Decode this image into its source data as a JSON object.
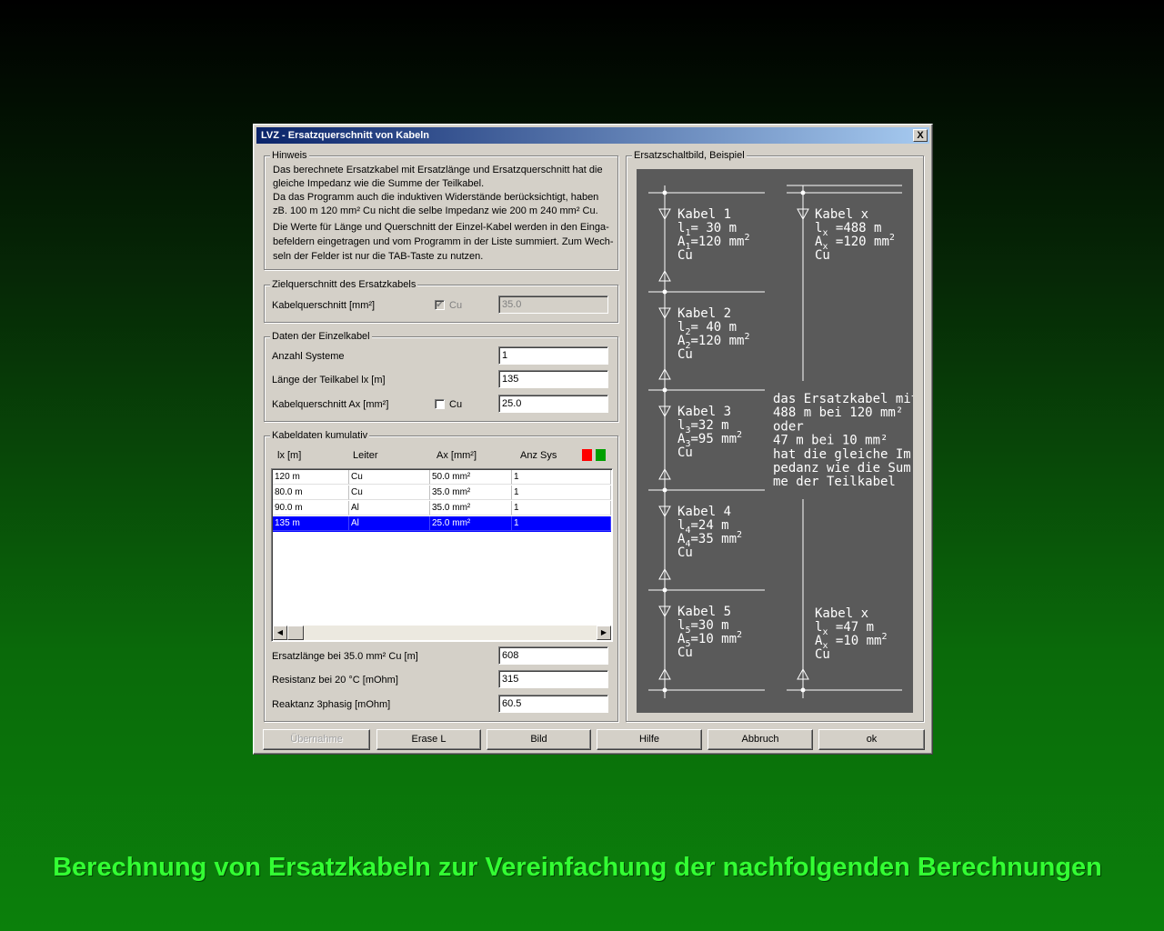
{
  "dialog": {
    "title": "LVZ - Ersatzquerschnitt von Kabeln",
    "close": "X"
  },
  "hinweis": {
    "label": "Hinweis",
    "lines": [
      "Das berechnete Ersatzkabel mit Ersatzlänge und Ersatzquerschnitt hat die",
      "gleiche Impedanz wie die Summe der Teilkabel.",
      "Da das Programm auch die induktiven Widerstände berücksichtigt, haben",
      "zB. 100 m 120 mm² Cu nicht die selbe Impedanz wie 200 m 240 mm² Cu.",
      "Die Werte für Länge und Querschnitt der Einzel-Kabel werden in den Einga-",
      "befeldern eingetragen und vom Programm in der Liste summiert. Zum Wech-",
      "seln der Felder ist nur die TAB-Taste zu nutzen."
    ]
  },
  "ziel": {
    "label": "Zielquerschnitt des Ersatzkabels",
    "field_label": "Kabelquerschnitt [mm²]",
    "cu_label": "Cu",
    "cu_checked": "✔",
    "value": "35.0"
  },
  "einzel": {
    "label": "Daten der Einzelkabel",
    "anzahl_label": "Anzahl Systeme",
    "anzahl_value": "1",
    "laenge_label": "Länge der Teilkabel lx [m]",
    "laenge_value": "135",
    "quer_label": "Kabelquerschnitt Ax [mm²]",
    "cu_label": "Cu",
    "quer_value": "25.0"
  },
  "kumulativ": {
    "label": "Kabeldaten kumulativ",
    "headers": [
      "lx [m]",
      "Leiter",
      "Ax [mm²]",
      "Anz Sys"
    ],
    "indicator_colors": [
      "#ff0000",
      "#00a000"
    ],
    "rows": [
      [
        "120 m",
        "Cu",
        "50.0 mm²",
        "1"
      ],
      [
        "80.0 m",
        "Cu",
        "35.0 mm²",
        "1"
      ],
      [
        "90.0 m",
        "Al",
        "35.0 mm²",
        "1"
      ],
      [
        "135 m",
        "Al",
        "25.0 mm²",
        "1"
      ]
    ],
    "selected_row": 3,
    "ersatz_label": "Ersatzlänge bei 35.0 mm² Cu [m]",
    "ersatz_value": "608",
    "resistanz_label": "Resistanz bei 20 °C [mOhm]",
    "resistanz_value": "315",
    "reaktanz_label": "Reaktanz 3phasig [mOhm]",
    "reaktanz_value": "60.5"
  },
  "schaltbild": {
    "label": "Ersatzschaltbild, Beispiel",
    "left": [
      {
        "name": "Kabel 1",
        "l": "l",
        "l_sub": "1",
        "l_val": "=  30  m",
        "a": "A",
        "a_sub": "1",
        "a_val": "=120  mm",
        "sup": "2",
        "mat": "Cu"
      },
      {
        "name": "Kabel 2",
        "l": "l",
        "l_sub": "2",
        "l_val": "=  40  m",
        "a": "A",
        "a_sub": "2",
        "a_val": "=120  mm",
        "sup": "2",
        "mat": "Cu"
      },
      {
        "name": "Kabel 3",
        "l": "l",
        "l_sub": "3",
        "l_val": "=32  m",
        "a": "A",
        "a_sub": "3",
        "a_val": "=95  mm",
        "sup": "2",
        "mat": "Cu"
      },
      {
        "name": "Kabel 4",
        "l": "l",
        "l_sub": "4",
        "l_val": "=24  m",
        "a": "A",
        "a_sub": "4",
        "a_val": "=35  mm",
        "sup": "2",
        "mat": "Cu"
      },
      {
        "name": "Kabel 5",
        "l": "l",
        "l_sub": "5",
        "l_val": "=30  m",
        "a": "A",
        "a_sub": "5",
        "a_val": "=10  mm",
        "sup": "2",
        "mat": "Cu"
      }
    ],
    "right_top": {
      "name": "Kabel x",
      "l": "l",
      "l_sub": "x",
      "l_val": " =488  m",
      "a": "A",
      "a_sub": "x",
      "a_val": " =120  mm",
      "sup": "2",
      "mat": "Cu"
    },
    "right_bottom": {
      "name": "Kabel x",
      "l": "l",
      "l_sub": "x",
      "l_val": " =47  m",
      "a": "A",
      "a_sub": "x",
      "a_val": " =10  mm",
      "sup": "2",
      "mat": "Cu"
    },
    "middle_text": [
      "das Ersatzkabel mit",
      "488  m bei 120 mm²",
      "oder",
      "47  m bei 10 mm²",
      "hat die gleiche Im-",
      "pedanz wie die Sum-",
      "me  der  Teilkabel"
    ]
  },
  "buttons": {
    "uebernahme": "Übernahme",
    "erase": "Erase L",
    "bild": "Bild",
    "hilfe": "Hilfe",
    "abbruch": "Abbruch",
    "ok": "ok"
  },
  "caption": "Berechnung von Ersatzkabeln zur Vereinfachung der nachfolgenden Berechnungen"
}
